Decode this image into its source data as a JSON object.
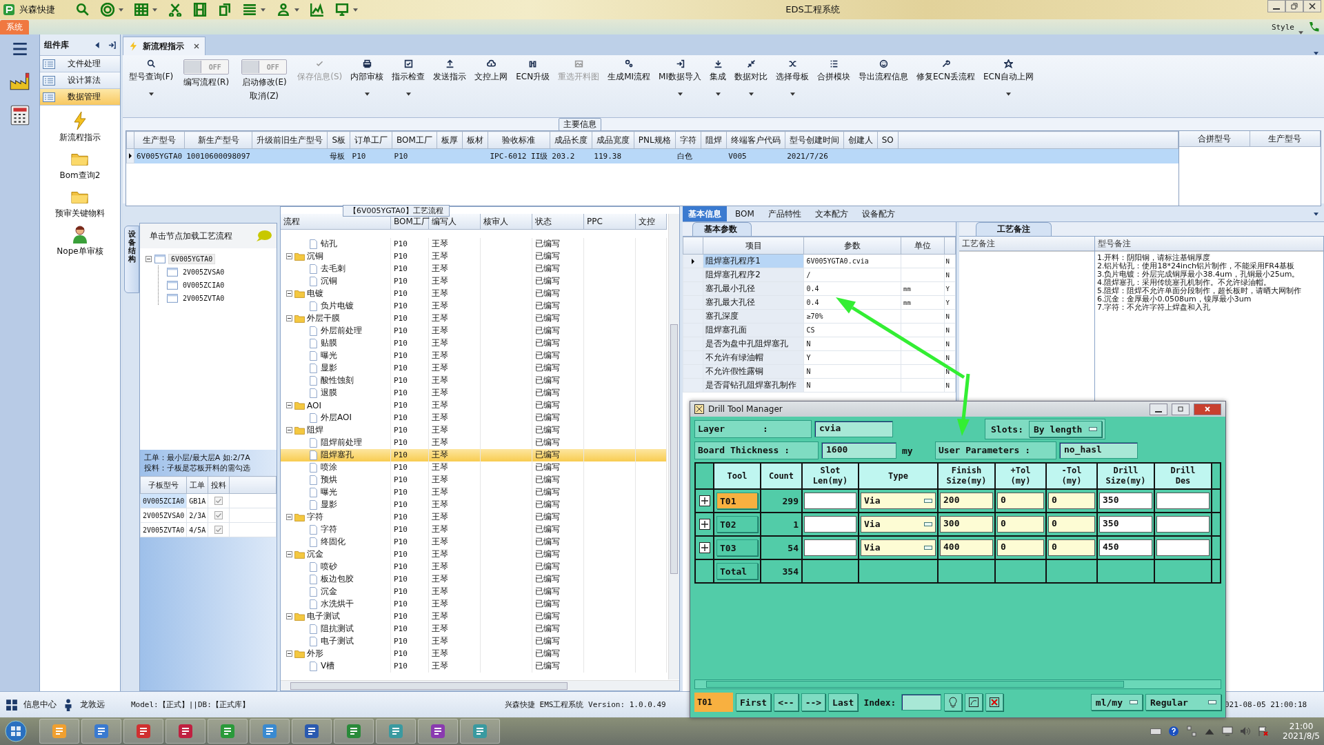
{
  "titlebar": {
    "app_name": "兴森快捷",
    "title": "EDS工程系统"
  },
  "menu_tab": {
    "label": "系统",
    "selected": true
  },
  "style_menu": "Style",
  "library": {
    "title": "组件库",
    "categories": [
      {
        "label": "文件处理",
        "selected": false
      },
      {
        "label": "设计算法",
        "selected": false
      },
      {
        "label": "数据管理",
        "selected": true
      }
    ],
    "items": [
      "新流程指示",
      "Bom查询2",
      "预审关键物料",
      "Nope单审核"
    ]
  },
  "document_tab": {
    "label": "新流程指示",
    "selected": true
  },
  "toolbar": [
    {
      "kind": "button",
      "label": "型号查询(F)",
      "dropdown": true,
      "disabled": false
    },
    {
      "kind": "toggle",
      "label": "编写流程(R)",
      "state_text": "OFF",
      "on": false
    },
    {
      "kind": "toggle",
      "label": "启动修改(E)",
      "sublabel": "取消(Z)",
      "state_text": "OFF",
      "on": false
    },
    {
      "kind": "button",
      "label": "保存信息(S)",
      "dropdown": false,
      "disabled": true
    },
    {
      "kind": "button",
      "label": "内部审核",
      "dropdown": true,
      "disabled": false
    },
    {
      "kind": "button",
      "label": "指示检查",
      "dropdown": true,
      "disabled": false
    },
    {
      "kind": "button",
      "label": "发送指示",
      "dropdown": false,
      "disabled": false
    },
    {
      "kind": "button",
      "label": "文控上网",
      "dropdown": false,
      "disabled": false
    },
    {
      "kind": "button",
      "label": "ECN升级",
      "dropdown": false,
      "disabled": false
    },
    {
      "kind": "button",
      "label": "重选开料图",
      "dropdown": false,
      "disabled": true
    },
    {
      "kind": "button",
      "label": "生成MI流程",
      "dropdown": false,
      "disabled": false
    },
    {
      "kind": "button",
      "label": "MI数据导入",
      "dropdown": true,
      "disabled": false
    },
    {
      "kind": "button",
      "label": "集成",
      "dropdown": true,
      "disabled": false
    },
    {
      "kind": "button",
      "label": "数据对比",
      "dropdown": true,
      "disabled": false
    },
    {
      "kind": "button",
      "label": "选择母板",
      "dropdown": true,
      "disabled": false
    },
    {
      "kind": "button",
      "label": "合拼模块",
      "dropdown": false,
      "disabled": false
    },
    {
      "kind": "button",
      "label": "导出流程信息",
      "dropdown": false,
      "disabled": false
    },
    {
      "kind": "button",
      "label": "修复ECN丢流程",
      "dropdown": false,
      "disabled": false
    },
    {
      "kind": "button",
      "label": "ECN自动上网",
      "dropdown": true,
      "disabled": false
    }
  ],
  "main_info": {
    "title": "主要信息",
    "columns": [
      "生产型号",
      "新生产型号",
      "升级前旧生产型号",
      "S板",
      "订单工厂",
      "BOM工厂",
      "板厚",
      "板材",
      "验收标准",
      "成品长度",
      "成品宽度",
      "PNL规格",
      "字符",
      "阻焊",
      "终端客户代码",
      "型号创建时间",
      "创建人",
      "SO"
    ],
    "rows": [
      {
        "selected": true,
        "cells": [
          "6V005YGTA0",
          "10010600098097",
          null,
          "母板",
          "P10",
          "P10",
          null,
          null,
          "IPC-6012 II级",
          "203.2",
          "119.38",
          null,
          "白色",
          null,
          "V005",
          "2021/7/26",
          null,
          null
        ]
      }
    ],
    "side_columns": [
      "合拼型号",
      "生产型号"
    ]
  },
  "structure_panel": {
    "tab": "设备结构",
    "header": "单击节点加载工艺流程",
    "tree": {
      "label": "6V005YGTA0",
      "expanded": true,
      "selected": true,
      "children": [
        {
          "label": "2V005ZVSA0",
          "selected": false
        },
        {
          "label": "0V005ZCIA0",
          "selected": false
        },
        {
          "label": "2V005ZVTA0",
          "selected": false
        }
      ]
    },
    "notes": [
      "工单：最小层/最大层A 如:2/7A",
      "投料：子板是芯板开料的需勾选"
    ],
    "columns": [
      "子板型号",
      "工单",
      "投料"
    ],
    "rows": [
      {
        "board": "0V005ZCIA0",
        "order": "GB1A",
        "checked": true,
        "selected": true
      },
      {
        "board": "2V005ZVSA0",
        "order": "2/3A",
        "checked": true,
        "selected": false
      },
      {
        "board": "2V005ZVTA0",
        "order": "4/5A",
        "checked": true,
        "selected": false
      }
    ]
  },
  "process_panel": {
    "title": "【6V005YGTA0】工艺流程",
    "columns": [
      "流程",
      "BOM工厂",
      "编写人",
      "核审人",
      "状态",
      "PPC",
      "文控"
    ],
    "steps": [
      {
        "name": "钻孔",
        "bom": "P10",
        "writer": "王琴",
        "status": "已编写",
        "selected": false
      },
      {
        "name": "沉铜",
        "bom": "P10",
        "writer": "王琴",
        "status": "已编写",
        "selected": false,
        "expanded": true,
        "children": [
          {
            "name": "去毛刺",
            "bom": "P10",
            "writer": "王琴",
            "status": "已编写",
            "selected": false
          },
          {
            "name": "沉铜",
            "bom": "P10",
            "writer": "王琴",
            "status": "已编写",
            "selected": false
          }
        ]
      },
      {
        "name": "电镀",
        "bom": "P10",
        "writer": "王琴",
        "status": "已编写",
        "selected": false,
        "expanded": true,
        "children": [
          {
            "name": "负片电镀",
            "bom": "P10",
            "writer": "王琴",
            "status": "已编写",
            "selected": false
          }
        ]
      },
      {
        "name": "外层干膜",
        "bom": "P10",
        "writer": "王琴",
        "status": "已编写",
        "selected": false,
        "expanded": true,
        "children": [
          {
            "name": "外层前处理",
            "bom": "P10",
            "writer": "王琴",
            "status": "已编写",
            "selected": false
          },
          {
            "name": "贴膜",
            "bom": "P10",
            "writer": "王琴",
            "status": "已编写",
            "selected": false
          },
          {
            "name": "曝光",
            "bom": "P10",
            "writer": "王琴",
            "status": "已编写",
            "selected": false
          },
          {
            "name": "显影",
            "bom": "P10",
            "writer": "王琴",
            "status": "已编写",
            "selected": false
          },
          {
            "name": "酸性蚀刻",
            "bom": "P10",
            "writer": "王琴",
            "status": "已编写",
            "selected": false
          },
          {
            "name": "退膜",
            "bom": "P10",
            "writer": "王琴",
            "status": "已编写",
            "selected": false
          }
        ]
      },
      {
        "name": "AOI",
        "bom": "P10",
        "writer": "王琴",
        "status": "已编写",
        "selected": false,
        "expanded": true,
        "children": [
          {
            "name": "外层AOI",
            "bom": "P10",
            "writer": "王琴",
            "status": "已编写",
            "selected": false
          }
        ]
      },
      {
        "name": "阻焊",
        "bom": "P10",
        "writer": "王琴",
        "status": "已编写",
        "selected": false,
        "expanded": true,
        "children": [
          {
            "name": "阻焊前处理",
            "bom": "P10",
            "writer": "王琴",
            "status": "已编写",
            "selected": false
          },
          {
            "name": "阻焊塞孔",
            "bom": "P10",
            "writer": "王琴",
            "status": "已编写",
            "selected": true
          },
          {
            "name": "喷涂",
            "bom": "P10",
            "writer": "王琴",
            "status": "已编写",
            "selected": false
          },
          {
            "name": "预烘",
            "bom": "P10",
            "writer": "王琴",
            "status": "已编写",
            "selected": false
          },
          {
            "name": "曝光",
            "bom": "P10",
            "writer": "王琴",
            "status": "已编写",
            "selected": false
          },
          {
            "name": "显影",
            "bom": "P10",
            "writer": "王琴",
            "status": "已编写",
            "selected": false
          }
        ]
      },
      {
        "name": "字符",
        "bom": "P10",
        "writer": "王琴",
        "status": "已编写",
        "selected": false,
        "expanded": true,
        "children": [
          {
            "name": "字符",
            "bom": "P10",
            "writer": "王琴",
            "status": "已编写",
            "selected": false
          },
          {
            "name": "终固化",
            "bom": "P10",
            "writer": "王琴",
            "status": "已编写",
            "selected": false
          }
        ]
      },
      {
        "name": "沉金",
        "bom": "P10",
        "writer": "王琴",
        "status": "已编写",
        "selected": false,
        "expanded": true,
        "children": [
          {
            "name": "喷砂",
            "bom": "P10",
            "writer": "王琴",
            "status": "已编写",
            "selected": false
          },
          {
            "name": "板边包胶",
            "bom": "P10",
            "writer": "王琴",
            "status": "已编写",
            "selected": false
          },
          {
            "name": "沉金",
            "bom": "P10",
            "writer": "王琴",
            "status": "已编写",
            "selected": false
          },
          {
            "name": "水洗烘干",
            "bom": "P10",
            "writer": "王琴",
            "status": "已编写",
            "selected": false
          }
        ]
      },
      {
        "name": "电子测试",
        "bom": "P10",
        "writer": "王琴",
        "status": "已编写",
        "selected": false,
        "expanded": true,
        "children": [
          {
            "name": "阻抗测试",
            "bom": "P10",
            "writer": "王琴",
            "status": "已编写",
            "selected": false
          },
          {
            "name": "电子测试",
            "bom": "P10",
            "writer": "王琴",
            "status": "已编写",
            "selected": false
          }
        ]
      },
      {
        "name": "外形",
        "bom": "P10",
        "writer": "王琴",
        "status": "已编写",
        "selected": false,
        "expanded": true,
        "children": [
          {
            "name": "V槽",
            "bom": "P10",
            "writer": "王琴",
            "status": "已编写",
            "selected": false
          }
        ]
      }
    ]
  },
  "info_tabs": [
    {
      "label": "基本信息",
      "selected": true
    },
    {
      "label": "BOM",
      "selected": false
    },
    {
      "label": "产品特性",
      "selected": false
    },
    {
      "label": "文本配方",
      "selected": false
    },
    {
      "label": "设备配方",
      "selected": false
    }
  ],
  "param_panel": {
    "tab": "基本参数",
    "columns": [
      "项目",
      "参数",
      "单位"
    ],
    "rows": [
      {
        "item": "阻焊塞孔程序1",
        "value": "6V005YGTA0.cvia",
        "flag": "N",
        "selected": true
      },
      {
        "item": "阻焊塞孔程序2",
        "value": "/",
        "flag": "N",
        "selected": false
      },
      {
        "item": "塞孔最小孔径",
        "value": "0.4",
        "unit": "mm",
        "flag": "Y",
        "selected": false
      },
      {
        "item": "塞孔最大孔径",
        "value": "0.4",
        "unit": "mm",
        "flag": "Y",
        "selected": false
      },
      {
        "item": "塞孔深度",
        "value": "≥70%",
        "flag": "N",
        "selected": false
      },
      {
        "item": "阻焊塞孔面",
        "value": "CS",
        "flag": "N",
        "selected": false
      },
      {
        "item": "是否为盘中孔阻焊塞孔",
        "value": "N",
        "flag": "N",
        "selected": false
      },
      {
        "item": "不允许有绿油帽",
        "value": "Y",
        "flag": "N",
        "selected": false
      },
      {
        "item": "不允许假性露铜",
        "value": "N",
        "flag": "N",
        "selected": false
      },
      {
        "item": "是否背钻孔阻焊塞孔制作",
        "value": "N",
        "flag": "N",
        "selected": false
      }
    ]
  },
  "remark_panel": {
    "tab": "工艺备注",
    "columns": [
      "工艺备注",
      "型号备注"
    ],
    "model_notes": [
      "1.开料：阴阳铜，请标注基铜厚度",
      "2.铝片钻孔：使用18*24inch铝片制作，不能采用FR4基板",
      "3.负片电镀：外层完成铜厚最小38.4um，孔铜最小25um。",
      "4.阻焊塞孔：采用传统塞孔机制作。不允许绿油帽。",
      "5.阻焊：阻焊不允许单面分段制作，超长板时，请晒大网制作",
      "6.沉金：金厚最小0.0508um，镍厚最小3um",
      "7.字符：不允许字符上焊盘和入孔"
    ]
  },
  "status_bar": {
    "items": [
      "信息中心",
      "龙敦远"
    ],
    "model": "Model:【正式】||DB:【正式库】",
    "version": "兴森快捷 EMS工程系统 Version: 1.0.0.49",
    "datetime": "021-08-05 21:00:18"
  },
  "taskbar": {
    "time": "21:00",
    "date": "2021/8/5"
  },
  "drill_window": {
    "title": "Drill Tool Manager",
    "layer_label": "Layer       :",
    "layer": "cvia",
    "slots_label": "Slots:",
    "slots": "By length",
    "thickness_label": "Board Thickness :",
    "thickness": "1600",
    "thickness_unit": "my",
    "user_params_label": "User Parameters :",
    "user_params": "no_hasl",
    "columns": [
      "Tool",
      "Count",
      "Slot\nLen(my)",
      "Type",
      "Finish\nSize(my)",
      "+Tol\n(my)",
      "-Tol\n(my)",
      "Drill\nSize(my)",
      "Drill\nDes"
    ],
    "rows": [
      {
        "tool": "T01",
        "count": "299",
        "type": "Via",
        "finish": "200",
        "plus_tol": "0",
        "minus_tol": "0",
        "drill_size": "350",
        "selected": true
      },
      {
        "tool": "T02",
        "count": "1",
        "type": "Via",
        "finish": "300",
        "plus_tol": "0",
        "minus_tol": "0",
        "drill_size": "350",
        "selected": false
      },
      {
        "tool": "T03",
        "count": "54",
        "type": "Via",
        "finish": "400",
        "plus_tol": "0",
        "minus_tol": "0",
        "drill_size": "450",
        "selected": false
      }
    ],
    "total": {
      "label": "Total",
      "count": "354"
    },
    "current": "T01",
    "nav_buttons": [
      "First",
      "<--",
      "-->",
      "Last"
    ],
    "index_label": "Index:",
    "units": "ml/my",
    "mode": "Regular"
  }
}
